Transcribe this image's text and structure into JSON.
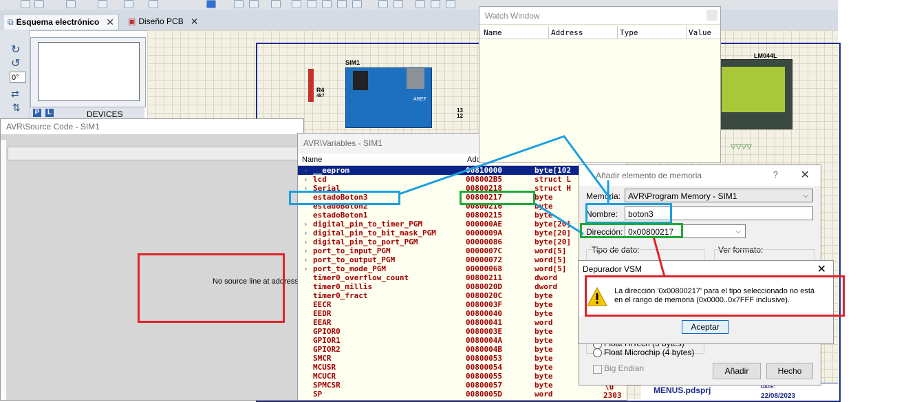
{
  "tabs": [
    {
      "label": "Esquema electrónico",
      "active": true
    },
    {
      "label": "Diseño PCB",
      "active": false
    }
  ],
  "left_panel": {
    "angle": "0°",
    "devices_label": "DEVICES",
    "mode_p": "P",
    "mode_l": "L"
  },
  "schematic": {
    "sim_label": "SIM1",
    "resistor_name": "R4",
    "resistor_value": "4k7",
    "lcd_label": "LM044L",
    "aref_label": "AREF",
    "pin13": "13",
    "pin12": "12",
    "project_file": "MENUS.pdsprj",
    "date_label": "DATE:",
    "date_value": "22/08/2023"
  },
  "source_window": {
    "title": "AVR\\Source Code - SIM1",
    "message": "No source line at address"
  },
  "variables_window": {
    "title": "AVR\\Variables - SIM1",
    "col_name": "Name",
    "col_address": "Add",
    "rows": [
      {
        "name": "__eeprom",
        "address": "00810000",
        "type": "byte[102",
        "expand": "›",
        "selected": true
      },
      {
        "name": "lcd",
        "address": "008002B5",
        "type": "struct L",
        "expand": "›"
      },
      {
        "name": "Serial",
        "address": "00800218",
        "type": "struct H",
        "expand": "›"
      },
      {
        "name": "estadoBoton3",
        "address": "00800217",
        "type": "byte",
        "expand": ""
      },
      {
        "name": "estadoBoton2",
        "address": "00800216",
        "type": "byte",
        "expand": ""
      },
      {
        "name": "estadoBoton1",
        "address": "00800215",
        "type": "byte",
        "expand": ""
      },
      {
        "name": "digital_pin_to_timer_PGM",
        "address": "000000AE",
        "type": "byte[20]",
        "expand": "›"
      },
      {
        "name": "digital_pin_to_bit_mask_PGM",
        "address": "0000009A",
        "type": "byte[20]",
        "expand": "›"
      },
      {
        "name": "digital_pin_to_port_PGM",
        "address": "00000086",
        "type": "byte[20]",
        "expand": "›"
      },
      {
        "name": "port_to_input_PGM",
        "address": "0000007C",
        "type": "word[5]",
        "expand": "›"
      },
      {
        "name": "port_to_output_PGM",
        "address": "00000072",
        "type": "word[5]",
        "expand": "›"
      },
      {
        "name": "port_to_mode_PGM",
        "address": "00000068",
        "type": "word[5]",
        "expand": "›"
      },
      {
        "name": "timer0_overflow_count",
        "address": "00800211",
        "type": "dword",
        "expand": ""
      },
      {
        "name": "timer0_millis",
        "address": "0080020D",
        "type": "dword",
        "expand": ""
      },
      {
        "name": "timer0_fract",
        "address": "0080020C",
        "type": "byte",
        "expand": ""
      },
      {
        "name": "EECR",
        "address": "0080003F",
        "type": "byte",
        "expand": ""
      },
      {
        "name": "EEDR",
        "address": "00800040",
        "type": "byte",
        "expand": ""
      },
      {
        "name": "EEAR",
        "address": "00800041",
        "type": "word",
        "expand": ""
      },
      {
        "name": "GPIOR0",
        "address": "0080003E",
        "type": "byte",
        "expand": ""
      },
      {
        "name": "GPIOR1",
        "address": "0080004A",
        "type": "byte",
        "expand": ""
      },
      {
        "name": "GPIOR2",
        "address": "0080004B",
        "type": "byte",
        "expand": ""
      },
      {
        "name": "SMCR",
        "address": "00800053",
        "type": "byte",
        "expand": ""
      },
      {
        "name": "MCUSR",
        "address": "00800054",
        "type": "byte",
        "expand": ""
      },
      {
        "name": "MCUCR",
        "address": "00800055",
        "type": "byte",
        "expand": ""
      },
      {
        "name": "SPMCSR",
        "address": "00800057",
        "type": "byte",
        "expand": ""
      },
      {
        "name": "SP",
        "address": "0080005D",
        "type": "word",
        "expand": ""
      }
    ],
    "extra_value": "\\0",
    "sp_value": "2303"
  },
  "watch_window": {
    "title": "Watch Window",
    "col_name": "Name",
    "col_address": "Address",
    "col_type": "Type",
    "col_value": "Value"
  },
  "add_dialog": {
    "title": "Añadir elemento de memoria",
    "help": "?",
    "close": "✕",
    "memoria_label": "Memoria:",
    "memoria_value": "AVR\\Program Memory - SIM1",
    "nombre_label": "Nombre:",
    "nombre_value": "boton3",
    "direccion_label": "Dirección:",
    "direccion_value": "0x00800217",
    "tipo_label": "Tipo de dato:",
    "formato_label": "Ver formato:",
    "float_hitech": "Float HiTech (3 bytes)",
    "float_microchip": "Float Microchip (4 bytes)",
    "big_endian": "Big Endian",
    "add_button": "Añadir",
    "done_button": "Hecho"
  },
  "error_dialog": {
    "title": "Depurador VSM",
    "close": "✕",
    "message": "La dirección '0x00800217' para el tipo seleccionado no está en el rango de memoria (0x0000..0x7FFF inclusive).",
    "ok_button": "Aceptar"
  },
  "colors": {
    "annotation_blue": "#1a9fe0",
    "annotation_green": "#21a838",
    "annotation_red": "#e0202a",
    "selection": "#0a2387",
    "var_text": "#a30000"
  }
}
